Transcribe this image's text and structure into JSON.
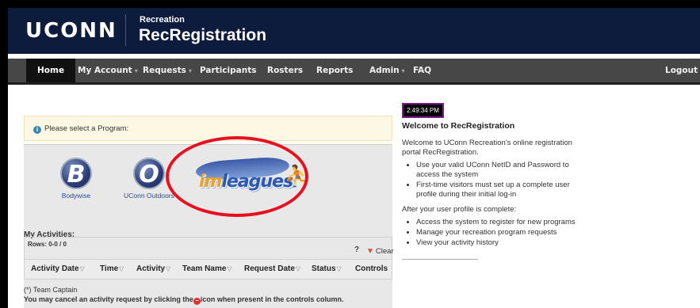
{
  "header": {
    "logo": "UCONN",
    "subtitle": "Recreation",
    "title": "RecRegistration"
  },
  "nav": {
    "items": [
      {
        "label": "Home",
        "active": true
      },
      {
        "label": "My Account",
        "caret": true
      },
      {
        "label": "Requests",
        "caret": true
      },
      {
        "label": "Participants"
      },
      {
        "label": "Rosters"
      },
      {
        "label": "Reports"
      },
      {
        "label": "Admin",
        "caret": true
      },
      {
        "label": "FAQ"
      }
    ],
    "logout": "Logout"
  },
  "notice": {
    "text": "Please select a Program:",
    "icon": "info-icon"
  },
  "programs": [
    {
      "letter": "B",
      "label": "Bodywise"
    },
    {
      "letter": "O",
      "label": "UConn Outdoors"
    },
    {
      "logo_im": "im",
      "logo_rest": "leagues",
      "label": ""
    }
  ],
  "activities": {
    "heading": "My Activities:",
    "rows": "Rows: 0-0 / 0",
    "help": "?",
    "clear": "Clear",
    "columns": [
      "Activity Date",
      "Time",
      "Activity",
      "Team Name",
      "Request Date",
      "Status",
      "Controls"
    ],
    "captain_note": "(*) Team Captain",
    "cancel_note_before": "You may cancel an activity request by clicking the",
    "cancel_note_after": "icon when present in the controls column."
  },
  "clock": "2:49:34 PM",
  "welcome": {
    "heading": "Welcome to RecRegistration",
    "intro": "Welcome to UConn Recreation's online registration portal RecRegistration.",
    "list1": [
      "Use your valid UConn NetID and Password to access the system",
      "First-time visitors must set up a complete user profile during their initial log-in"
    ],
    "after": "After your user profile is complete:",
    "list2": [
      "Access the system to register for new programs",
      "Manage your recreation program requests",
      "View your activity history"
    ]
  },
  "colors": {
    "header_bg": "#0d1b3d",
    "nav_bg": "#474747",
    "highlight_ring": "#e8101e"
  }
}
